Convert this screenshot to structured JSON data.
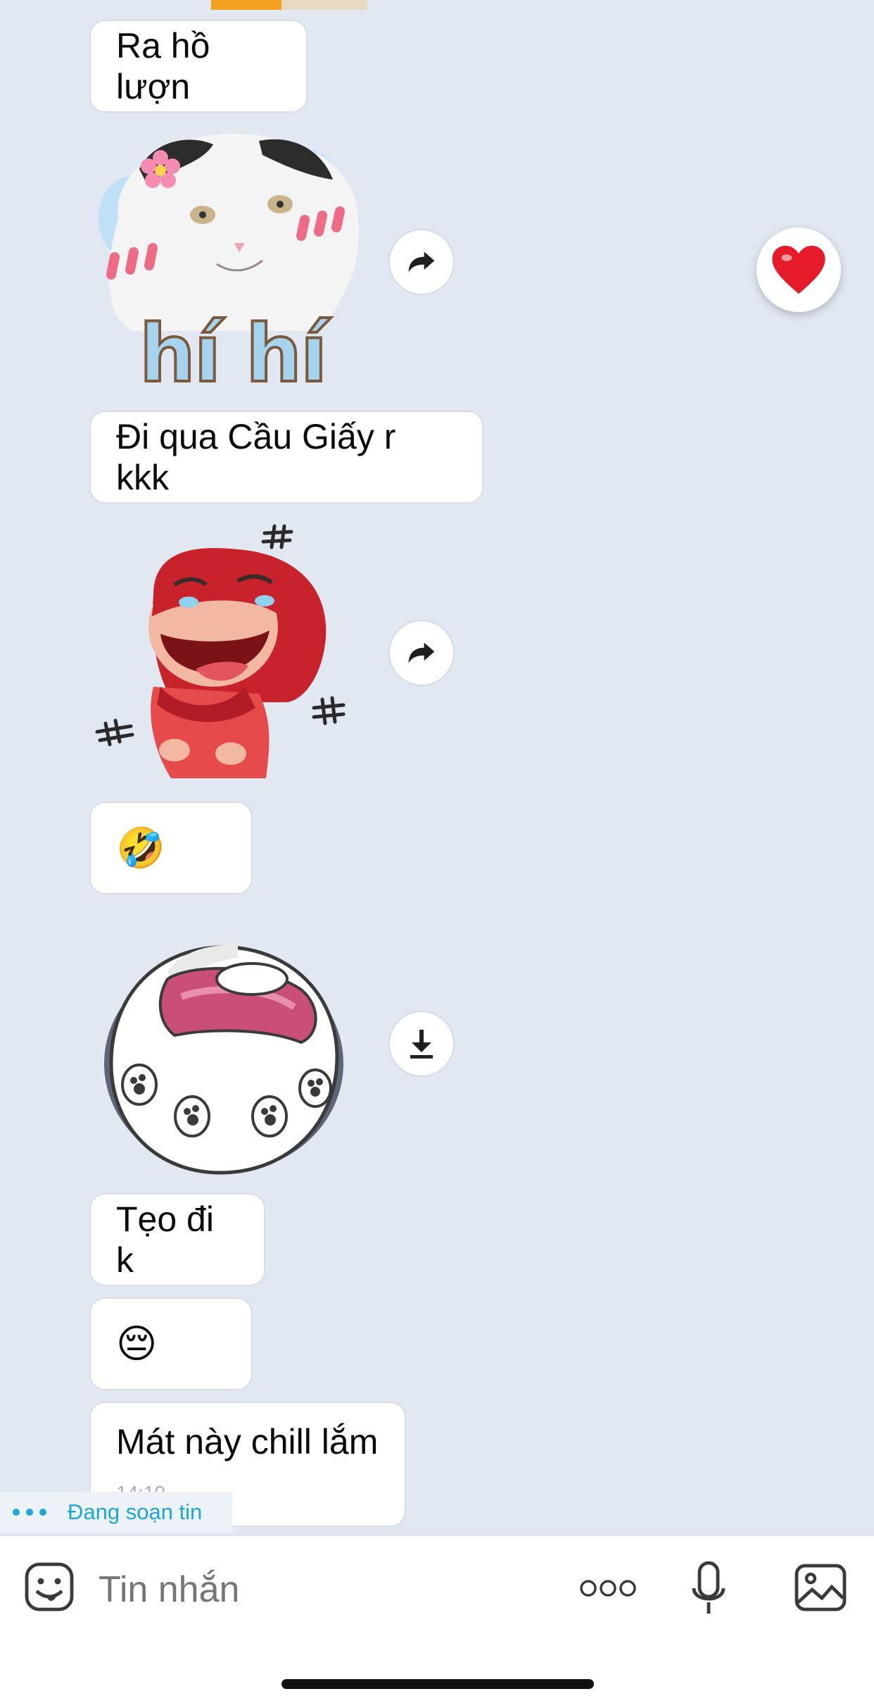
{
  "messages": [
    {
      "text": "Ra hồ lượn"
    },
    {
      "text": "Đi qua Cầu Giấy r kkk"
    },
    {
      "emoji": "🤣"
    },
    {
      "text": "Tẹo đi k"
    },
    {
      "emoji": "😔"
    },
    {
      "text": "Mát này chill lắm",
      "time": "14:10"
    }
  ],
  "sticker_caption": "hí hí",
  "typing_indicator": "Đang soạn tin",
  "input": {
    "placeholder": "Tin nhắn"
  },
  "reaction_emoji": "❤",
  "colors": {
    "accent": "#1aa7d8",
    "background": "#e2e8f1",
    "heart": "#e51b2a"
  }
}
